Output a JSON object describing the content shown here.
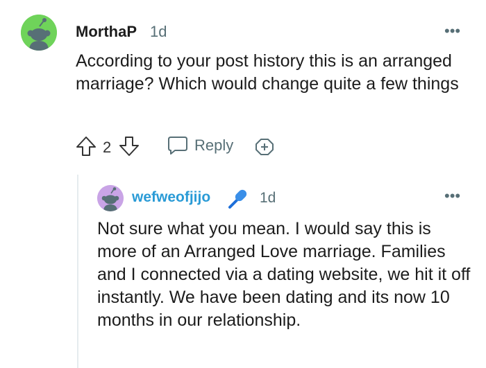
{
  "comment": {
    "author": "MorthaP",
    "age": "1d",
    "more_glyph": "•••",
    "body": "According to your post history this is an arranged marriage? Which would change quite a few things",
    "votes": "2",
    "reply_label": "Reply",
    "avatar_color": "#6fd35a"
  },
  "reply": {
    "author": "wefweofjijo",
    "age": "1d",
    "more_glyph": "•••",
    "body": "Not sure what you mean. I would say this is more of an Arranged Love marriage. Families and I connected via a dating website, we hit it off instantly. We have been dating and its now 10 months in our relationship.",
    "avatar_color": "#c9a4e6",
    "author_color": "#2a9bd6",
    "flair_icon": "microphone-icon"
  },
  "icons": [
    "snoo-avatar-icon",
    "upvote-icon",
    "downvote-icon",
    "reply-bubble-icon",
    "award-icon",
    "more-options-icon",
    "microphone-icon"
  ]
}
